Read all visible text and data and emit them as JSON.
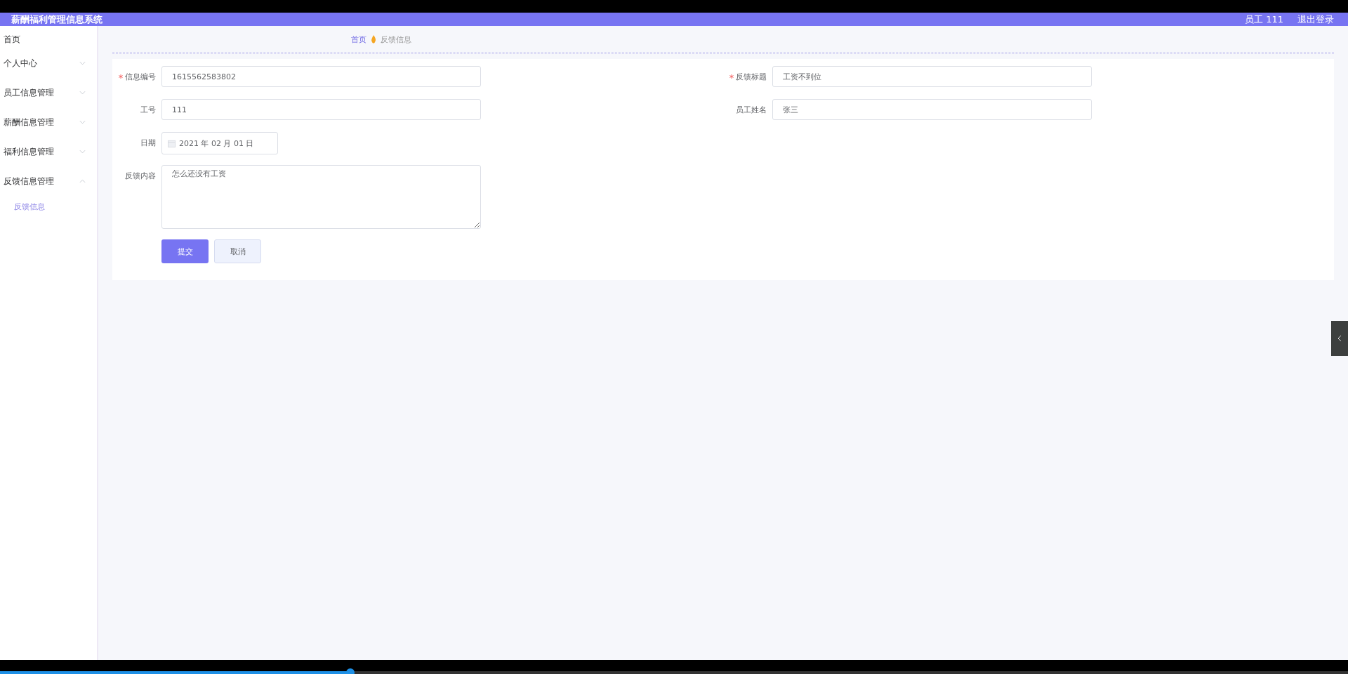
{
  "header": {
    "title": "薪酬福利管理信息系统",
    "user": "员工 111",
    "logout": "退出登录"
  },
  "sidebar": {
    "items": [
      {
        "label": "首页"
      },
      {
        "label": "个人中心",
        "expanded": false
      },
      {
        "label": "员工信息管理",
        "expanded": false
      },
      {
        "label": "薪酬信息管理",
        "expanded": false
      },
      {
        "label": "福利信息管理",
        "expanded": false
      },
      {
        "label": "反馈信息管理",
        "expanded": true,
        "children": [
          {
            "label": "反馈信息",
            "selected": true
          }
        ]
      }
    ]
  },
  "breadcrumb": [
    "首页",
    "反馈信息"
  ],
  "form": {
    "rows": [
      [
        {
          "label": "信息编号",
          "required": true,
          "kind": "input",
          "value": "1615562583802"
        },
        {
          "label": "反馈标题",
          "required": true,
          "kind": "input",
          "value": "工资不到位"
        }
      ],
      [
        {
          "label": "工号",
          "required": false,
          "kind": "input",
          "value": "111"
        },
        {
          "label": "员工姓名",
          "required": false,
          "kind": "input",
          "value": "张三"
        }
      ],
      [
        {
          "label": "日期",
          "required": false,
          "kind": "date",
          "value": "2021 年 02 月 01 日"
        }
      ],
      [
        {
          "label": "反馈内容",
          "required": false,
          "kind": "textarea",
          "value": "怎么还没有工资"
        }
      ]
    ],
    "submit": "提交",
    "cancel": "取消"
  },
  "video_player": {
    "level": 0.26
  }
}
